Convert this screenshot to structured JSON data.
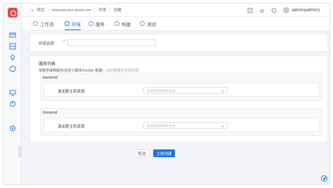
{
  "breadcrumb": {
    "items": [
      "项目",
      "microservice-demo-vm",
      "环境",
      "创建"
    ],
    "separator": "/"
  },
  "header": {
    "user": "admin(admin)",
    "icons": [
      "document-icon",
      "bell-icon",
      "help-icon"
    ]
  },
  "sidebar": {
    "icons": [
      "logo-icon",
      "project-icon",
      "package-icon",
      "rocket-icon",
      "security-icon",
      "monitor-icon",
      "chart-icon",
      "settings-icon"
    ]
  },
  "tabs": [
    {
      "label": "工作流",
      "active": false
    },
    {
      "label": "环境",
      "active": true
    },
    {
      "label": "服务",
      "active": false
    },
    {
      "label": "构建",
      "active": false
    },
    {
      "label": "测试",
      "active": false
    }
  ],
  "env_form": {
    "name_label": "环境名称",
    "required_mark": "*",
    "name_value": ""
  },
  "services": {
    "title": "服务列表",
    "subtitle": "单服务或微服务(自定义脚本/Docker 部署)",
    "subtitle_hint": "(请依据服务选择资源)",
    "items": [
      {
        "name": "backend",
        "field_label": "请关联主机资源",
        "placeholder": "请选择要关联的主机"
      },
      {
        "name": "frontend",
        "field_label": "请关联主机资源",
        "placeholder": "请选择要关联的主机"
      }
    ]
  },
  "actions": {
    "cancel": "取消",
    "create": "立即创建"
  },
  "colors": {
    "primary": "#1f6feb",
    "logo": "#e34c4c",
    "background": "#f3f4f7"
  }
}
